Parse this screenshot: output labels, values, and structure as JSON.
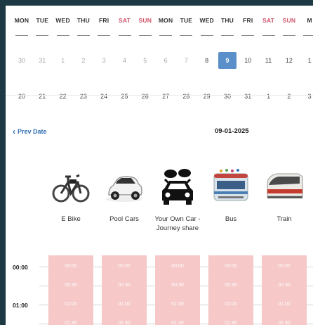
{
  "calendar": {
    "day_names": [
      "MON",
      "TUE",
      "WED",
      "THU",
      "FRI",
      "SAT",
      "SUN",
      "MON",
      "TUE",
      "WED",
      "THU",
      "FRI",
      "SAT",
      "SUN",
      "M"
    ],
    "weekend_indices": [
      5,
      6,
      12,
      13
    ],
    "week1": [
      "30",
      "31",
      "1",
      "2",
      "3",
      "4",
      "5",
      "6",
      "7",
      "8",
      "9",
      "10",
      "11",
      "12",
      "1"
    ],
    "week1_muted_until": 9,
    "selected_index": 10,
    "week2": [
      "20",
      "21",
      "22",
      "23",
      "24",
      "25",
      "26",
      "27",
      "28",
      "29",
      "30",
      "31",
      "1",
      "2",
      "3"
    ]
  },
  "nav": {
    "prev_label": "Prev Date",
    "current_date": "09-01-2025"
  },
  "modes": [
    {
      "label": "E Bike",
      "icon": "ebike-icon"
    },
    {
      "label": "Pool Cars",
      "icon": "car-icon"
    },
    {
      "label": "Your Own Car - Journey share",
      "icon": "journey-share-icon"
    },
    {
      "label": "Bus",
      "icon": "bus-icon"
    },
    {
      "label": "Train",
      "icon": "train-icon"
    }
  ],
  "timetable": {
    "hour_labels": [
      "00:00",
      "01:00"
    ],
    "slots": [
      "00:00",
      "00:30",
      "01:00",
      "01:30"
    ]
  },
  "colors": {
    "slot_bg": "#f6c8c8",
    "selected": "#5b8fc9",
    "weekend": "#d0546a",
    "link": "#2e6fb4"
  }
}
